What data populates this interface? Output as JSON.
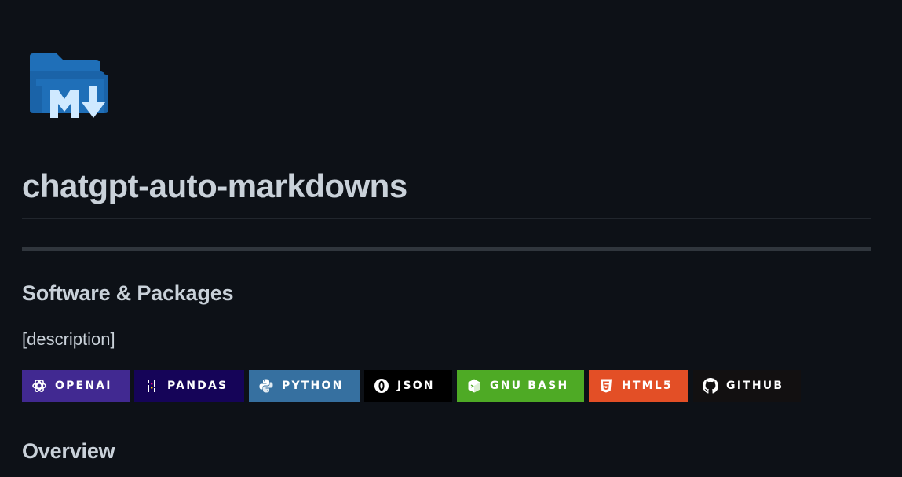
{
  "readme": {
    "title": "chatgpt-auto-markdowns",
    "sections": {
      "software": {
        "heading": "Software & Packages",
        "description": "[description]"
      },
      "overview": {
        "heading": "Overview"
      }
    }
  },
  "logo": {
    "icon": "folder-markdown-icon",
    "folder_color": "#1f6fb8",
    "mark_color": "#cfe9ff"
  },
  "badges": [
    {
      "label": "OPENAI",
      "icon": "openai-icon",
      "bg": "#412991",
      "width": 137
    },
    {
      "label": "PANDAS",
      "icon": "pandas-icon",
      "bg": "#150458",
      "width": 140
    },
    {
      "label": "PYTHON",
      "icon": "python-icon",
      "bg": "#3670a0",
      "width": 141
    },
    {
      "label": "JSON",
      "icon": "json-icon",
      "bg": "#000000",
      "width": 112
    },
    {
      "label": "GNU BASH",
      "icon": "bash-icon",
      "bg": "#4eaa25",
      "width": 162
    },
    {
      "label": "HTML5",
      "icon": "html5-icon",
      "bg": "#e34f26",
      "width": 127
    },
    {
      "label": "GITHUB",
      "icon": "github-icon",
      "bg": "#121011",
      "width": 137
    }
  ]
}
